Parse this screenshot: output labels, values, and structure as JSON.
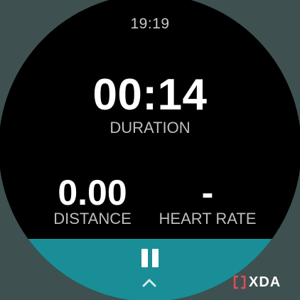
{
  "status_bar": {
    "time": "19:19"
  },
  "metrics": {
    "duration": {
      "value": "00:14",
      "label": "DURATION"
    },
    "distance": {
      "value": "0.00",
      "label": "DISTANCE"
    },
    "heart_rate": {
      "value": "-",
      "label": "HEART RATE"
    }
  },
  "controls": {
    "pause_icon": "pause-icon",
    "expand_icon": "chevron-up-icon",
    "band_color": "#1a8e96"
  },
  "watermark": {
    "text": "XDA"
  },
  "colors": {
    "background": "#3e5050",
    "face": "#000000",
    "accent": "#1a8e96",
    "watermark_bracket": "#e64a5a"
  }
}
